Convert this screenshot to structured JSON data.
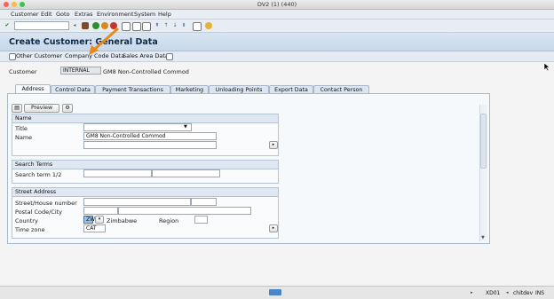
{
  "window": {
    "title": "DV2 (1) (440)"
  },
  "menubar": [
    "Customer",
    "Edit",
    "Goto",
    "Extras",
    "Environment",
    "System",
    "Help"
  ],
  "page": {
    "title": "Create Customer: General Data"
  },
  "app_toolbar": {
    "other_customer": "Other Customer",
    "company_code_data": "Company Code Data",
    "sales_area_data": "Sales Area Data"
  },
  "customer": {
    "label": "Customer",
    "value": "INTERNAL",
    "description": "GM8 Non-Controlled Commod"
  },
  "tabs": [
    "Address",
    "Control Data",
    "Payment Transactions",
    "Marketing",
    "Unloading Points",
    "Export Data",
    "Contact Person"
  ],
  "preview_label": "Preview",
  "name_group": {
    "heading": "Name",
    "title_label": "Title",
    "title_value": "",
    "name_label": "Name",
    "name1": "GM8 Non-Controlled Commod",
    "name2": ""
  },
  "search_group": {
    "heading": "Search Terms",
    "term_label": "Search term 1/2"
  },
  "street_group": {
    "heading": "Street Address",
    "street_label": "Street/House number",
    "postal_label": "Postal Code/City",
    "country_label": "Country",
    "country_code": "ZW",
    "country_name": "Zimbabwe",
    "region_label": "Region",
    "timezone_label": "Time zone",
    "timezone_value": "CAT"
  },
  "status": {
    "system": "XD01",
    "server": "chitdev",
    "mode": "INS"
  },
  "colors": {
    "arrow": "#e8891c",
    "header_bg": "#c7d8ea"
  }
}
